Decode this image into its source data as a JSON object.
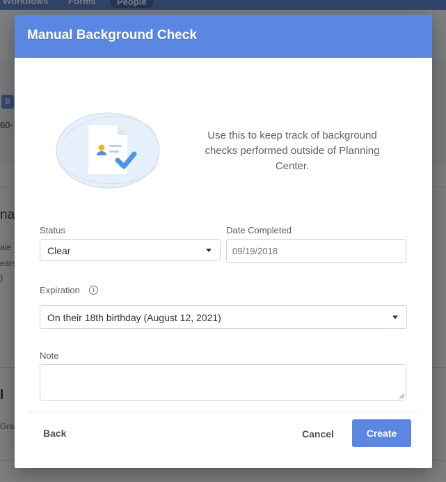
{
  "background": {
    "nav_items": [
      "Workflows",
      "Forms",
      "People"
    ],
    "fragments": {
      "badge": "B",
      "id_fragment": "60-",
      "name_fragment": "nal",
      "sale_fragment": "ale",
      "years_fragment": "ears",
      "dash_fragment": ")",
      "section_fragment": "l",
      "grad_fragment": "Grad"
    }
  },
  "modal": {
    "title": "Manual Background Check",
    "intro_text": "Use this to keep track of background checks performed outside of Planning Center.",
    "status": {
      "label": "Status",
      "value": "Clear"
    },
    "date_completed": {
      "label": "Date Completed",
      "value": "09/19/2018"
    },
    "expiration": {
      "label": "Expiration",
      "value": "On their 18th birthday (August 12, 2021)"
    },
    "note": {
      "label": "Note",
      "value": ""
    },
    "footer": {
      "back_label": "Back",
      "cancel_label": "Cancel",
      "create_label": "Create"
    }
  },
  "colors": {
    "header": "#5b87e3",
    "primary_button": "#5b87e3",
    "check_mark": "#4b95e6"
  },
  "icons": [
    "document-check-icon",
    "info-icon",
    "caret-down-icon",
    "resize-handle-icon"
  ]
}
